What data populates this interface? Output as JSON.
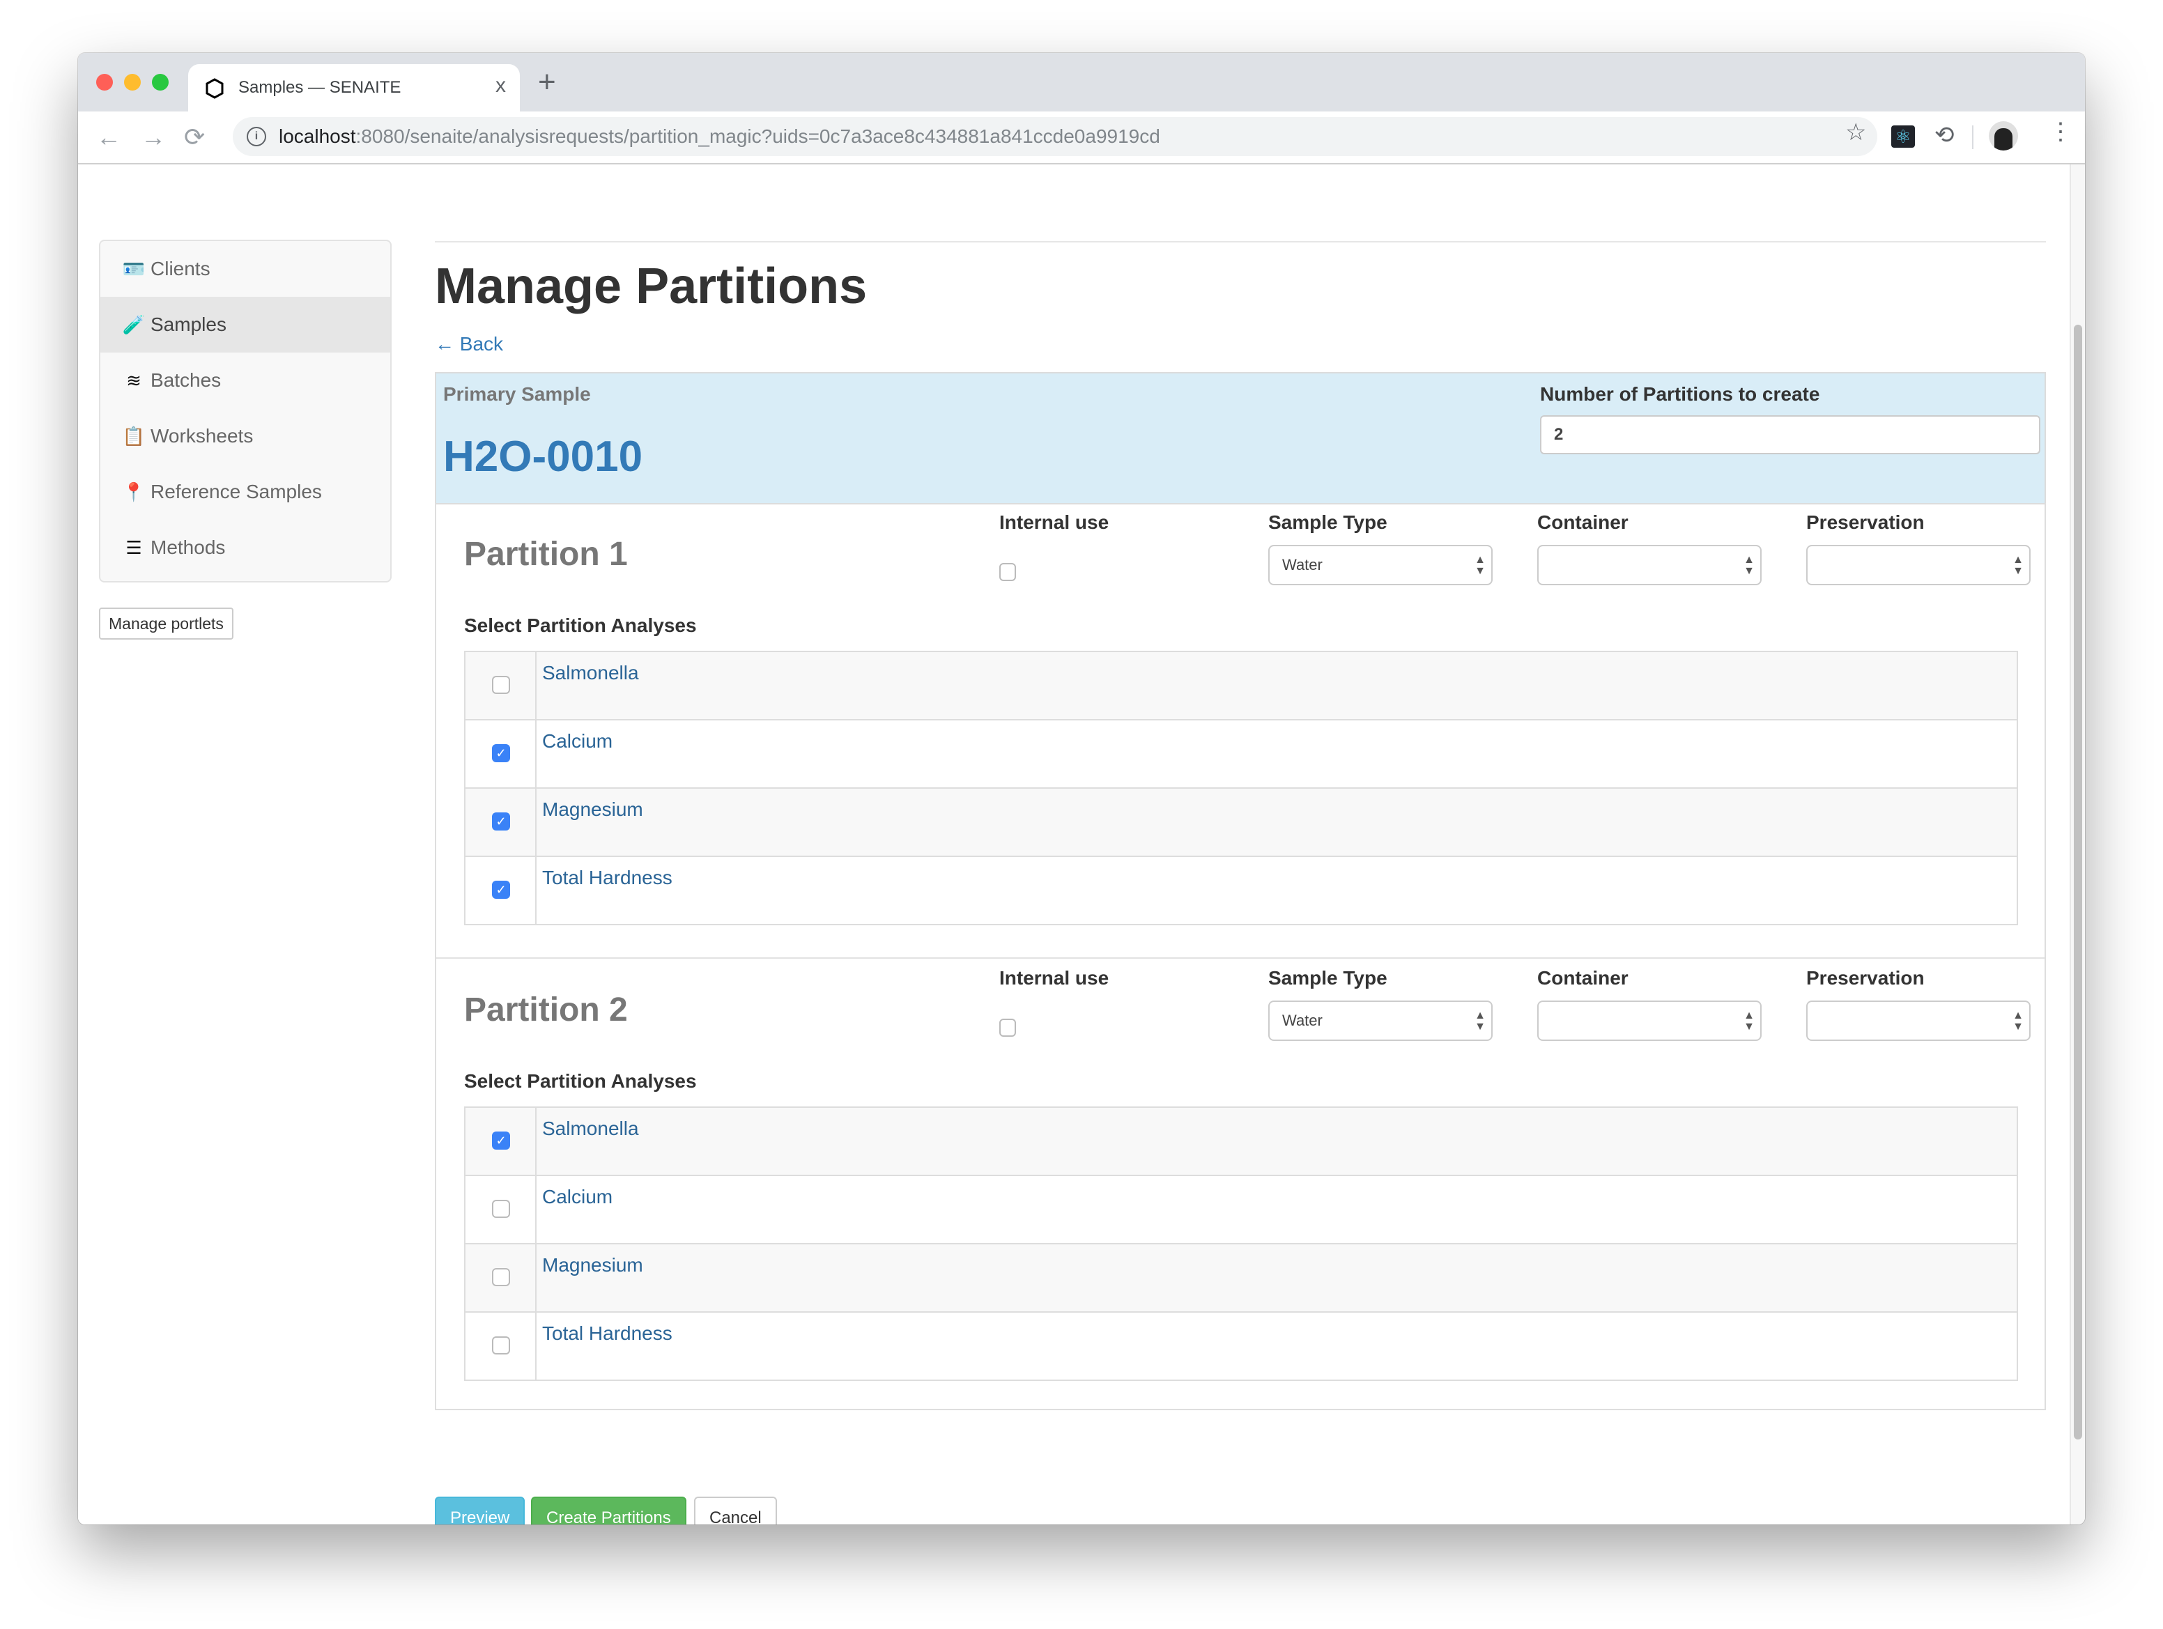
{
  "browser": {
    "tab_title": "Samples — SENAITE",
    "tab_close": "x",
    "new_tab": "+",
    "url_host": "localhost",
    "url_rest": ":8080/senaite/analysisrequests/partition_magic?uids=0c7a3ace8c434881a841ccde0a9919cd",
    "icons": {
      "back": "←",
      "forward": "→",
      "reload": "⟳",
      "info": "i",
      "star": "☆",
      "react_ext": "⚛",
      "sync_ext": "⟲",
      "menu": "⋮"
    }
  },
  "sidebar": {
    "items": [
      {
        "label": "Clients",
        "icon": "🪪",
        "active": false
      },
      {
        "label": "Samples",
        "icon": "🧪",
        "active": true
      },
      {
        "label": "Batches",
        "icon": "≋",
        "active": false
      },
      {
        "label": "Worksheets",
        "icon": "📋",
        "active": false
      },
      {
        "label": "Reference Samples",
        "icon": "📍",
        "active": false
      },
      {
        "label": "Methods",
        "icon": "☰",
        "active": false
      }
    ],
    "manage_portlets": "Manage portlets"
  },
  "main": {
    "title": "Manage Partitions",
    "back_link": "← Back",
    "primary_sample_label": "Primary Sample",
    "primary_sample_id": "H2O-0010",
    "num_partitions_label": "Number of Partitions to create",
    "num_partitions_value": "2"
  },
  "partitions": [
    {
      "title": "Partition 1",
      "internal_use_label": "Internal use",
      "internal_use": false,
      "sample_type_label": "Sample Type",
      "sample_type": "Water",
      "container_label": "Container",
      "container": "",
      "preservation_label": "Preservation",
      "preservation": "",
      "analyses_label": "Select Partition Analyses",
      "analyses": [
        {
          "name": "Salmonella",
          "checked": false
        },
        {
          "name": "Calcium",
          "checked": true
        },
        {
          "name": "Magnesium",
          "checked": true
        },
        {
          "name": "Total Hardness",
          "checked": true
        }
      ]
    },
    {
      "title": "Partition 2",
      "internal_use_label": "Internal use",
      "internal_use": false,
      "sample_type_label": "Sample Type",
      "sample_type": "Water",
      "container_label": "Container",
      "container": "",
      "preservation_label": "Preservation",
      "preservation": "",
      "analyses_label": "Select Partition Analyses",
      "analyses": [
        {
          "name": "Salmonella",
          "checked": true
        },
        {
          "name": "Calcium",
          "checked": false
        },
        {
          "name": "Magnesium",
          "checked": false
        },
        {
          "name": "Total Hardness",
          "checked": false
        }
      ]
    }
  ],
  "buttons": {
    "preview": "Preview",
    "create": "Create Partitions",
    "cancel": "Cancel"
  },
  "colors": {
    "link": "#337ab7",
    "primary_bg": "#d9edf7",
    "preview_btn": "#5bc0de",
    "create_btn": "#5cb85c",
    "checkbox_on": "#3a82f7"
  }
}
